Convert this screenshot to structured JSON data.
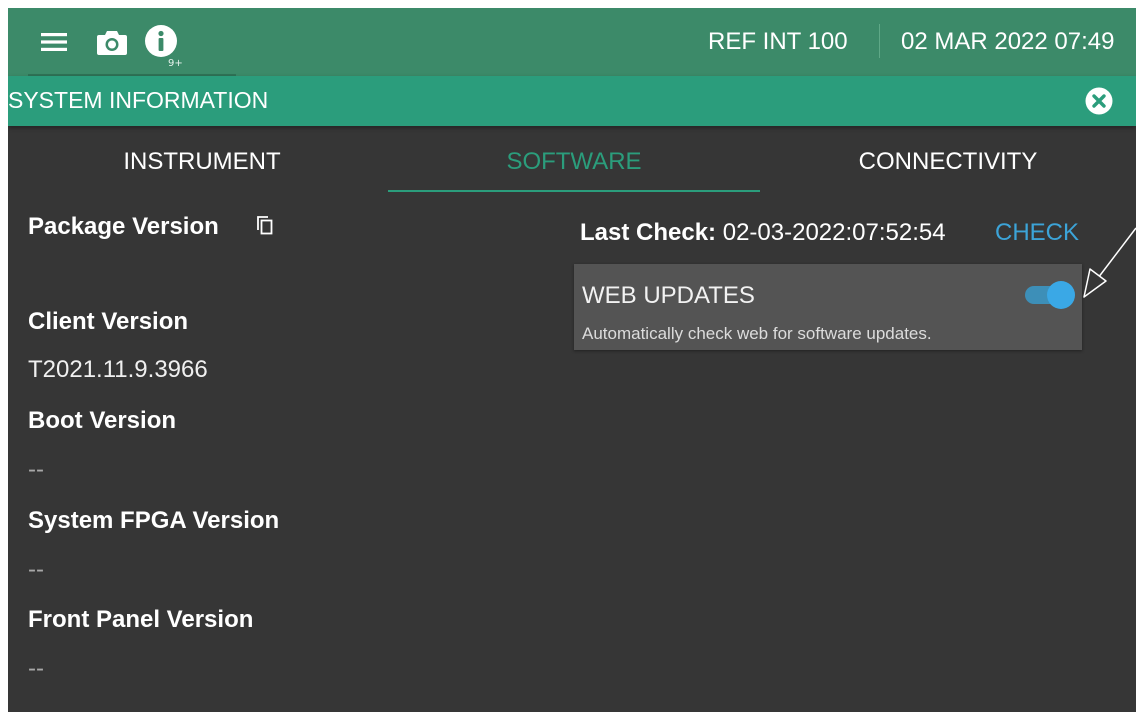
{
  "header": {
    "menu_icon": "hamburger-menu-icon",
    "camera_icon": "camera-icon",
    "info_icon": "info-icon",
    "badge_count": "9+",
    "reference": "REF INT 100",
    "datetime": "02 MAR 2022 07:49"
  },
  "titlebar": {
    "title": "SYSTEM INFORMATION",
    "close_icon": "close-circle-icon"
  },
  "tabs": [
    {
      "label": "INSTRUMENT",
      "active": false
    },
    {
      "label": "SOFTWARE",
      "active": true
    },
    {
      "label": "CONNECTIVITY",
      "active": false
    }
  ],
  "software": {
    "package_version": {
      "label": "Package Version",
      "value": "",
      "copy_icon": "copy-icon"
    },
    "client_version": {
      "label": "Client Version",
      "value": "T2021.11.9.3966"
    },
    "boot_version": {
      "label": "Boot Version",
      "value": "--"
    },
    "system_fpga_version": {
      "label": "System FPGA Version",
      "value": "--"
    },
    "front_panel_version": {
      "label": "Front Panel Version",
      "value": "--"
    },
    "last_check": {
      "label": "Last Check:",
      "value": "02-03-2022:07:52:54",
      "action": "CHECK"
    },
    "web_updates": {
      "title": "WEB UPDATES",
      "description": "Automatically check web for software updates.",
      "enabled": true
    }
  },
  "colors": {
    "header_bg": "#3c8a69",
    "titlebar_bg": "#2b9d7c",
    "panel_bg": "#363636",
    "accent_blue": "#3ca4d8",
    "active_tab": "#2b9d7c"
  }
}
